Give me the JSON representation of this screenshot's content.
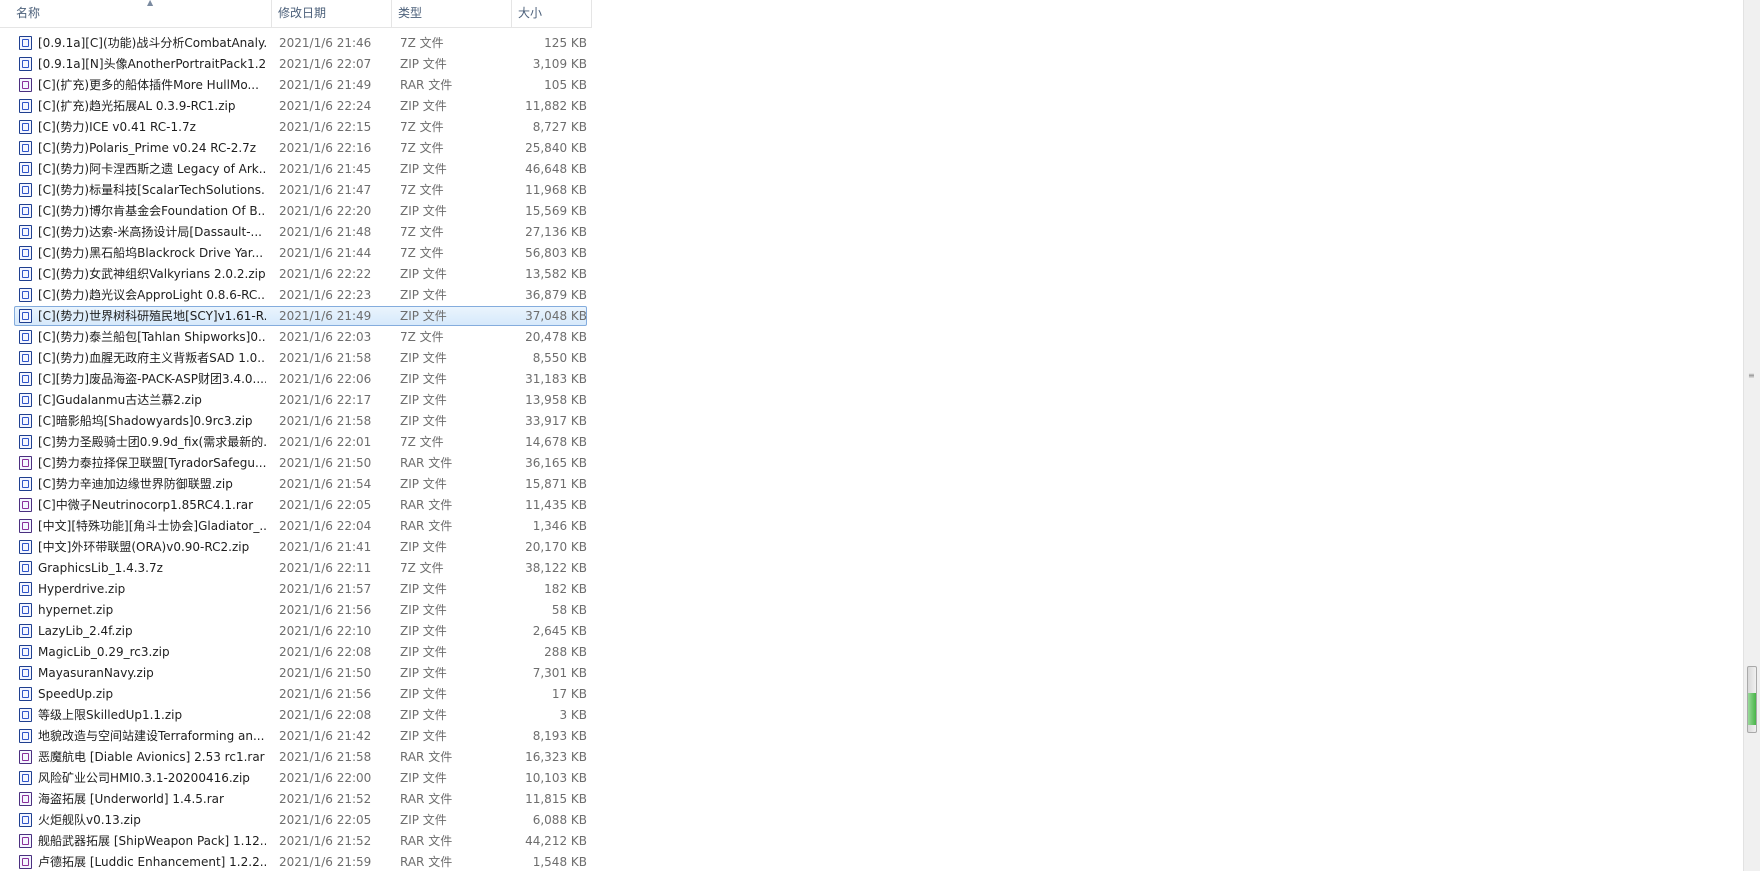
{
  "columns": {
    "name": "名称",
    "date": "修改日期",
    "type": "类型",
    "size": "大小"
  },
  "selected_index": 13,
  "files": [
    {
      "name": "[0.9.1a][C](功能)战斗分析CombatAnaly...",
      "date": "2021/1/6 21:46",
      "type": "7Z 文件",
      "size": "125 KB",
      "icon": "7z"
    },
    {
      "name": "[0.9.1a][N]头像AnotherPortraitPack1.2....",
      "date": "2021/1/6 22:07",
      "type": "ZIP 文件",
      "size": "3,109 KB",
      "icon": "zip"
    },
    {
      "name": "[C](扩充)更多的船体插件More HullMo...",
      "date": "2021/1/6 21:49",
      "type": "RAR 文件",
      "size": "105 KB",
      "icon": "rar"
    },
    {
      "name": "[C](扩充)趋光拓展AL  0.3.9-RC1.zip",
      "date": "2021/1/6 22:24",
      "type": "ZIP 文件",
      "size": "11,882 KB",
      "icon": "zip"
    },
    {
      "name": "[C](势力)ICE v0.41 RC-1.7z",
      "date": "2021/1/6 22:15",
      "type": "7Z 文件",
      "size": "8,727 KB",
      "icon": "7z"
    },
    {
      "name": "[C](势力)Polaris_Prime v0.24 RC-2.7z",
      "date": "2021/1/6 22:16",
      "type": "7Z 文件",
      "size": "25,840 KB",
      "icon": "7z"
    },
    {
      "name": "[C](势力)阿卡涅西斯之遗 Legacy of Ark...",
      "date": "2021/1/6 21:45",
      "type": "ZIP 文件",
      "size": "46,648 KB",
      "icon": "zip"
    },
    {
      "name": "[C](势力)标量科技[ScalarTechSolutions....",
      "date": "2021/1/6 21:47",
      "type": "7Z 文件",
      "size": "11,968 KB",
      "icon": "7z"
    },
    {
      "name": "[C](势力)博尔肯基金会Foundation Of B...",
      "date": "2021/1/6 22:20",
      "type": "ZIP 文件",
      "size": "15,569 KB",
      "icon": "zip"
    },
    {
      "name": "[C](势力)达索-米高扬设计局[Dassault-...",
      "date": "2021/1/6 21:48",
      "type": "7Z 文件",
      "size": "27,136 KB",
      "icon": "7z"
    },
    {
      "name": "[C](势力)黑石船坞Blackrock Drive Yar...",
      "date": "2021/1/6 21:44",
      "type": "7Z 文件",
      "size": "56,803 KB",
      "icon": "7z"
    },
    {
      "name": "[C](势力)女武神组织Valkyrians 2.0.2.zip",
      "date": "2021/1/6 22:22",
      "type": "ZIP 文件",
      "size": "13,582 KB",
      "icon": "zip"
    },
    {
      "name": "[C](势力)趋光议会ApproLight 0.8.6-RC...",
      "date": "2021/1/6 22:23",
      "type": "ZIP 文件",
      "size": "36,879 KB",
      "icon": "zip"
    },
    {
      "name": "[C](势力)世界树科研殖民地[SCY]v1.61-R...",
      "date": "2021/1/6 21:49",
      "type": "ZIP 文件",
      "size": "37,048 KB",
      "icon": "zip"
    },
    {
      "name": "[C](势力)泰兰船包[Tahlan Shipworks]0....",
      "date": "2021/1/6 22:03",
      "type": "7Z 文件",
      "size": "20,478 KB",
      "icon": "7z"
    },
    {
      "name": "[C](势力)血腥无政府主义背叛者SAD 1.0....",
      "date": "2021/1/6 21:58",
      "type": "ZIP 文件",
      "size": "8,550 KB",
      "icon": "zip"
    },
    {
      "name": "[C][势力]废品海盗-PACK-ASP财团3.4.0....",
      "date": "2021/1/6 22:06",
      "type": "ZIP 文件",
      "size": "31,183 KB",
      "icon": "zip"
    },
    {
      "name": "[C]Gudalanmu古达兰慕2.zip",
      "date": "2021/1/6 22:17",
      "type": "ZIP 文件",
      "size": "13,958 KB",
      "icon": "zip"
    },
    {
      "name": "[C]暗影船坞[Shadowyards]0.9rc3.zip",
      "date": "2021/1/6 21:58",
      "type": "ZIP 文件",
      "size": "33,917 KB",
      "icon": "zip"
    },
    {
      "name": "[C]势力圣殿骑士团0.9.9d_fix(需求最新的...",
      "date": "2021/1/6 22:01",
      "type": "7Z 文件",
      "size": "14,678 KB",
      "icon": "7z"
    },
    {
      "name": "[C]势力泰拉择保卫联盟[TyradorSafegu...",
      "date": "2021/1/6 21:50",
      "type": "RAR 文件",
      "size": "36,165 KB",
      "icon": "rar"
    },
    {
      "name": "[C]势力辛迪加边缘世界防御联盟.zip",
      "date": "2021/1/6 21:54",
      "type": "ZIP 文件",
      "size": "15,871 KB",
      "icon": "zip"
    },
    {
      "name": "[C]中微子Neutrinocorp1.85RC4.1.rar",
      "date": "2021/1/6 22:05",
      "type": "RAR 文件",
      "size": "11,435 KB",
      "icon": "rar"
    },
    {
      "name": "[中文][特殊功能][角斗士协会]Gladiator_...",
      "date": "2021/1/6 22:04",
      "type": "RAR 文件",
      "size": "1,346 KB",
      "icon": "rar"
    },
    {
      "name": "[中文]外环带联盟(ORA)v0.90-RC2.zip",
      "date": "2021/1/6 21:41",
      "type": "ZIP 文件",
      "size": "20,170 KB",
      "icon": "zip"
    },
    {
      "name": "GraphicsLib_1.4.3.7z",
      "date": "2021/1/6 22:11",
      "type": "7Z 文件",
      "size": "38,122 KB",
      "icon": "7z"
    },
    {
      "name": "Hyperdrive.zip",
      "date": "2021/1/6 21:57",
      "type": "ZIP 文件",
      "size": "182 KB",
      "icon": "zip"
    },
    {
      "name": "hypernet.zip",
      "date": "2021/1/6 21:56",
      "type": "ZIP 文件",
      "size": "58 KB",
      "icon": "zip"
    },
    {
      "name": "LazyLib_2.4f.zip",
      "date": "2021/1/6 22:10",
      "type": "ZIP 文件",
      "size": "2,645 KB",
      "icon": "zip"
    },
    {
      "name": "MagicLib_0.29_rc3.zip",
      "date": "2021/1/6 22:08",
      "type": "ZIP 文件",
      "size": "288 KB",
      "icon": "zip"
    },
    {
      "name": "MayasuranNavy.zip",
      "date": "2021/1/6 21:50",
      "type": "ZIP 文件",
      "size": "7,301 KB",
      "icon": "zip"
    },
    {
      "name": "SpeedUp.zip",
      "date": "2021/1/6 21:56",
      "type": "ZIP 文件",
      "size": "17 KB",
      "icon": "zip"
    },
    {
      "name": "等级上限SkilledUp1.1.zip",
      "date": "2021/1/6 22:08",
      "type": "ZIP 文件",
      "size": "3 KB",
      "icon": "zip"
    },
    {
      "name": "地貌改造与空间站建设Terraforming an...",
      "date": "2021/1/6 21:42",
      "type": "ZIP 文件",
      "size": "8,193 KB",
      "icon": "zip"
    },
    {
      "name": "恶魔航电 [Diable Avionics] 2.53 rc1.rar",
      "date": "2021/1/6 21:58",
      "type": "RAR 文件",
      "size": "16,323 KB",
      "icon": "rar"
    },
    {
      "name": "风险矿业公司HMI0.3.1-20200416.zip",
      "date": "2021/1/6 22:00",
      "type": "ZIP 文件",
      "size": "10,103 KB",
      "icon": "zip"
    },
    {
      "name": "海盗拓展 [Underworld] 1.4.5.rar",
      "date": "2021/1/6 21:52",
      "type": "RAR 文件",
      "size": "11,815 KB",
      "icon": "rar"
    },
    {
      "name": "火炬舰队v0.13.zip",
      "date": "2021/1/6 22:05",
      "type": "ZIP 文件",
      "size": "6,088 KB",
      "icon": "zip"
    },
    {
      "name": "舰船武器拓展 [ShipWeapon Pack] 1.12...",
      "date": "2021/1/6 21:52",
      "type": "RAR 文件",
      "size": "44,212 KB",
      "icon": "rar"
    },
    {
      "name": "卢德拓展 [Luddic Enhancement] 1.2.2....",
      "date": "2021/1/6 21:59",
      "type": "RAR 文件",
      "size": "1,548 KB",
      "icon": "rar"
    }
  ]
}
